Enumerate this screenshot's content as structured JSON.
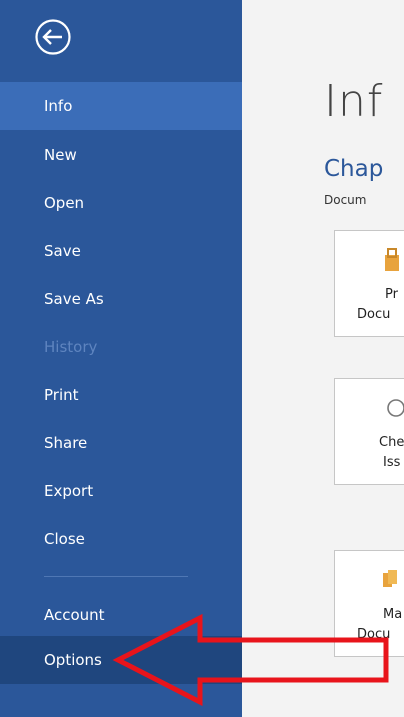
{
  "sidebar": {
    "items": [
      {
        "label": "Info"
      },
      {
        "label": "New"
      },
      {
        "label": "Open"
      },
      {
        "label": "Save"
      },
      {
        "label": "Save As"
      },
      {
        "label": "History"
      },
      {
        "label": "Print"
      },
      {
        "label": "Share"
      },
      {
        "label": "Export"
      },
      {
        "label": "Close"
      },
      {
        "label": "Account"
      },
      {
        "label": "Options"
      }
    ]
  },
  "main": {
    "title": "Inf",
    "doc_title": "Chap",
    "doc_path": "Docum",
    "cards": [
      {
        "line1": "Pr",
        "line2": "Docu"
      },
      {
        "line1": "Che",
        "line2": "Iss"
      },
      {
        "line1": "Ma",
        "line2": "Docu"
      }
    ]
  },
  "colors": {
    "sidebar_bg": "#2b579a",
    "active_item": "#3b6db8",
    "selected_item": "#1f467e",
    "annotation_arrow": "#e8141b"
  }
}
